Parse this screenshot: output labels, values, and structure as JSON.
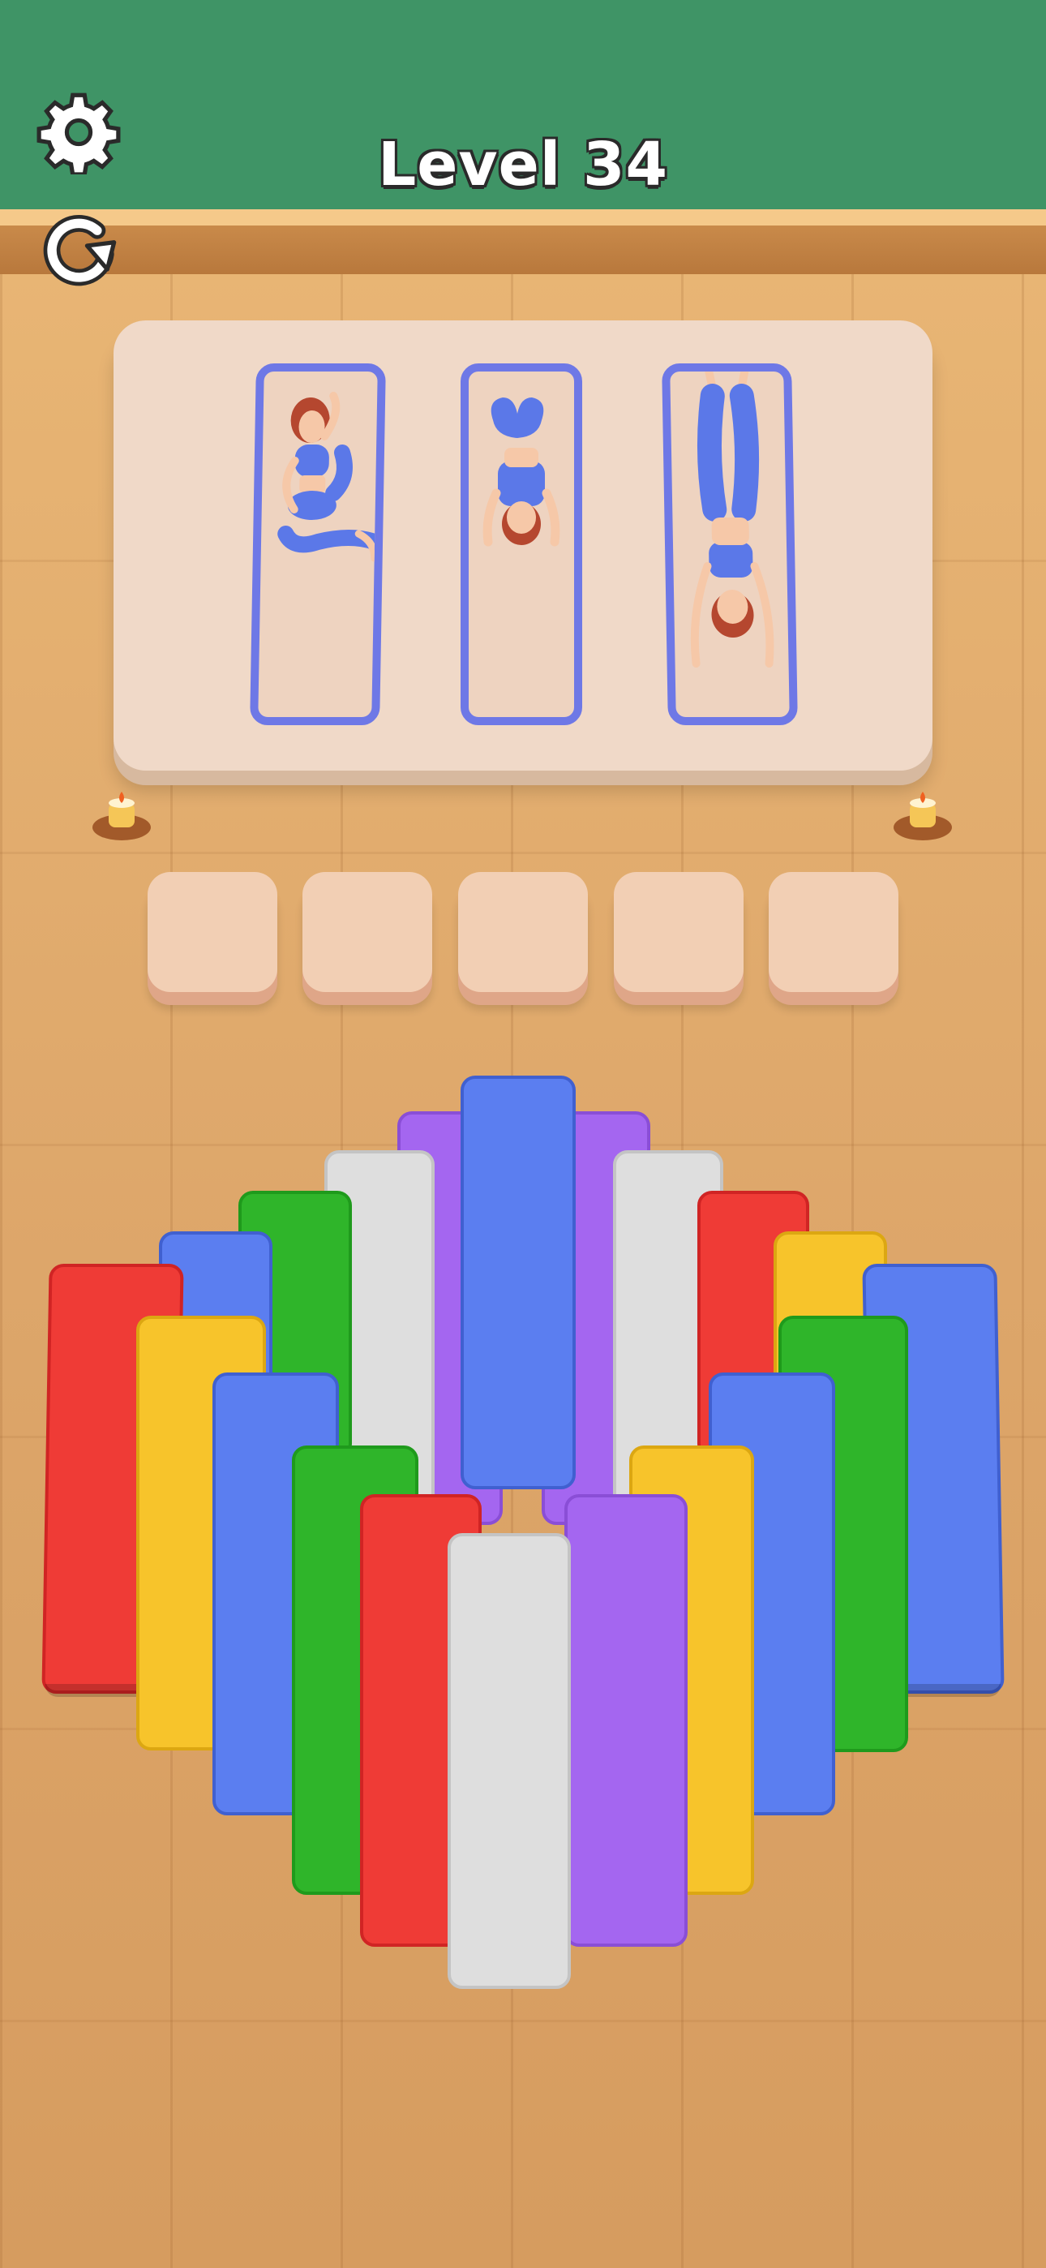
{
  "hud": {
    "level_label": "Level 34",
    "settings_icon": "gear-icon",
    "restart_icon": "restart-icon"
  },
  "colors": {
    "wall": "#3f9466",
    "board": "#f0d9c8",
    "slot_outline": "#6e78e6",
    "outfit": "#5b78e8",
    "hair": "#b5472f",
    "mat_red": "#ef3b36",
    "mat_blue": "#5b7ef0",
    "mat_yellow": "#f7c42b",
    "mat_green": "#2fb52a",
    "mat_purple": "#a466f0",
    "mat_white": "#dedede"
  },
  "slots": [
    {
      "pose": "seated-twist"
    },
    {
      "pose": "lying-legs-up"
    },
    {
      "pose": "lying-arms-down"
    }
  ],
  "holding_pads": [
    {
      "state": "empty"
    },
    {
      "state": "empty"
    },
    {
      "state": "empty"
    },
    {
      "state": "empty"
    },
    {
      "state": "empty"
    }
  ],
  "mats": [
    "red",
    "blue",
    "yellow",
    "green",
    "purple",
    "white"
  ]
}
